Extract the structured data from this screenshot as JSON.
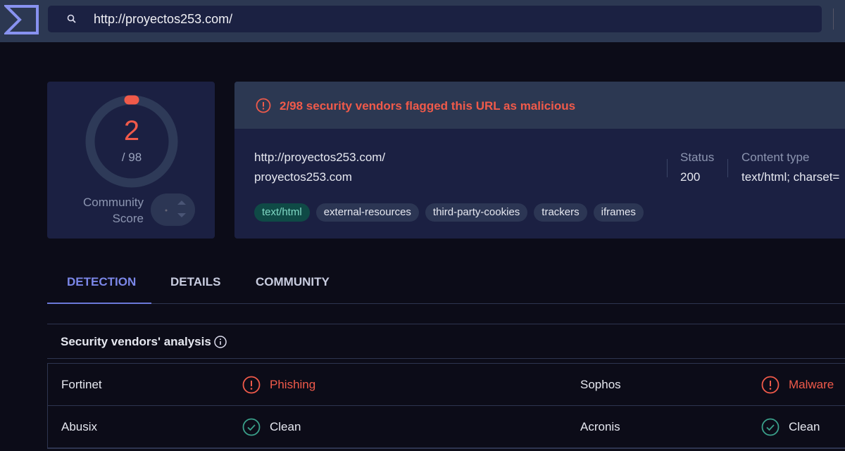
{
  "search": {
    "url": "http://proyectos253.com/"
  },
  "score": {
    "detections": "2",
    "total": "/ 98",
    "fraction": 0.0204,
    "community_label_1": "Community",
    "community_label_2": "Score"
  },
  "banner": {
    "message": "2/98 security vendors flagged this URL as malicious",
    "url": "http://proyectos253.com/",
    "domain": "proyectos253.com",
    "status_label": "Status",
    "status_value": "200",
    "content_type_label": "Content type",
    "content_type_value": "text/html; charset=",
    "tags": [
      "text/html",
      "external-resources",
      "third-party-cookies",
      "trackers",
      "iframes"
    ]
  },
  "tabs": [
    "DETECTION",
    "DETAILS",
    "COMMUNITY"
  ],
  "section": {
    "title": "Security vendors' analysis"
  },
  "vendors": [
    {
      "left_name": "Fortinet",
      "left_result": "Phishing",
      "left_status": "malicious",
      "right_name": "Sophos",
      "right_result": "Malware",
      "right_status": "malicious"
    },
    {
      "left_name": "Abusix",
      "left_result": "Clean",
      "left_status": "clean",
      "right_name": "Acronis",
      "right_result": "Clean",
      "right_status": "clean"
    }
  ],
  "colors": {
    "malicious": "#f05a4a",
    "clean": "#3aa08a",
    "accent": "#7b87e8"
  }
}
